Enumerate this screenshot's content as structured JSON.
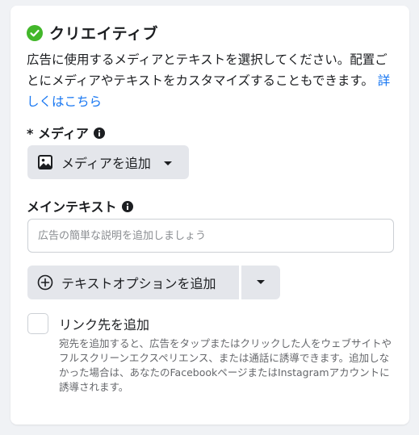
{
  "section": {
    "title": "クリエイティブ",
    "status_icon": "check-circle-icon",
    "status_color": "#42b72a",
    "description": "広告に使用するメディアとテキストを選択してください。配置ごとにメディアやテキストをカスタマイズすることもできます。",
    "learn_more_link": "詳しくはこちら",
    "link_color": "#1877f2"
  },
  "media": {
    "label": "* メディア",
    "add_button_label": "メディアを追加"
  },
  "main_text": {
    "label": "メインテキスト",
    "placeholder": "広告の簡単な説明を追加しましょう",
    "value": ""
  },
  "text_options": {
    "add_button_label": "テキストオプションを追加"
  },
  "destination": {
    "checkbox_label": "リンク先を追加",
    "checked": false,
    "help_text": "宛先を追加すると、広告をタップまたはクリックした人をウェブサイトやフルスクリーンエクスペリエンス、または通話に誘導できます。追加しなかった場合は、あなたのFacebookページまたはInstagramアカウントに誘導されます。"
  }
}
